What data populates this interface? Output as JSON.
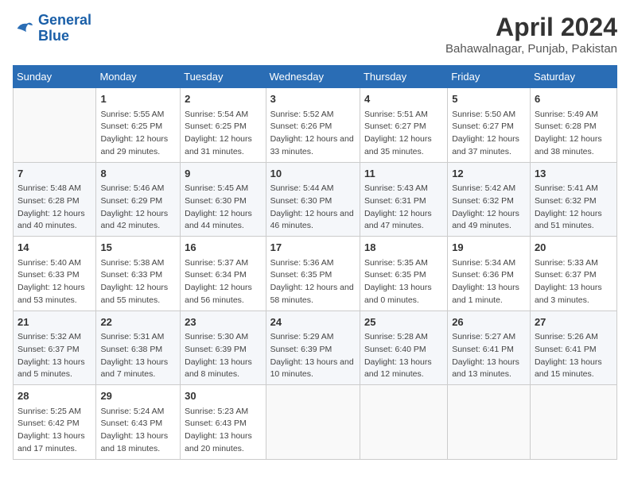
{
  "header": {
    "logo_line1": "General",
    "logo_line2": "Blue",
    "month": "April 2024",
    "location": "Bahawalnagar, Punjab, Pakistan"
  },
  "weekdays": [
    "Sunday",
    "Monday",
    "Tuesday",
    "Wednesday",
    "Thursday",
    "Friday",
    "Saturday"
  ],
  "weeks": [
    [
      {
        "day": "",
        "sunrise": "",
        "sunset": "",
        "daylight": ""
      },
      {
        "day": "1",
        "sunrise": "Sunrise: 5:55 AM",
        "sunset": "Sunset: 6:25 PM",
        "daylight": "Daylight: 12 hours and 29 minutes."
      },
      {
        "day": "2",
        "sunrise": "Sunrise: 5:54 AM",
        "sunset": "Sunset: 6:25 PM",
        "daylight": "Daylight: 12 hours and 31 minutes."
      },
      {
        "day": "3",
        "sunrise": "Sunrise: 5:52 AM",
        "sunset": "Sunset: 6:26 PM",
        "daylight": "Daylight: 12 hours and 33 minutes."
      },
      {
        "day": "4",
        "sunrise": "Sunrise: 5:51 AM",
        "sunset": "Sunset: 6:27 PM",
        "daylight": "Daylight: 12 hours and 35 minutes."
      },
      {
        "day": "5",
        "sunrise": "Sunrise: 5:50 AM",
        "sunset": "Sunset: 6:27 PM",
        "daylight": "Daylight: 12 hours and 37 minutes."
      },
      {
        "day": "6",
        "sunrise": "Sunrise: 5:49 AM",
        "sunset": "Sunset: 6:28 PM",
        "daylight": "Daylight: 12 hours and 38 minutes."
      }
    ],
    [
      {
        "day": "7",
        "sunrise": "Sunrise: 5:48 AM",
        "sunset": "Sunset: 6:28 PM",
        "daylight": "Daylight: 12 hours and 40 minutes."
      },
      {
        "day": "8",
        "sunrise": "Sunrise: 5:46 AM",
        "sunset": "Sunset: 6:29 PM",
        "daylight": "Daylight: 12 hours and 42 minutes."
      },
      {
        "day": "9",
        "sunrise": "Sunrise: 5:45 AM",
        "sunset": "Sunset: 6:30 PM",
        "daylight": "Daylight: 12 hours and 44 minutes."
      },
      {
        "day": "10",
        "sunrise": "Sunrise: 5:44 AM",
        "sunset": "Sunset: 6:30 PM",
        "daylight": "Daylight: 12 hours and 46 minutes."
      },
      {
        "day": "11",
        "sunrise": "Sunrise: 5:43 AM",
        "sunset": "Sunset: 6:31 PM",
        "daylight": "Daylight: 12 hours and 47 minutes."
      },
      {
        "day": "12",
        "sunrise": "Sunrise: 5:42 AM",
        "sunset": "Sunset: 6:32 PM",
        "daylight": "Daylight: 12 hours and 49 minutes."
      },
      {
        "day": "13",
        "sunrise": "Sunrise: 5:41 AM",
        "sunset": "Sunset: 6:32 PM",
        "daylight": "Daylight: 12 hours and 51 minutes."
      }
    ],
    [
      {
        "day": "14",
        "sunrise": "Sunrise: 5:40 AM",
        "sunset": "Sunset: 6:33 PM",
        "daylight": "Daylight: 12 hours and 53 minutes."
      },
      {
        "day": "15",
        "sunrise": "Sunrise: 5:38 AM",
        "sunset": "Sunset: 6:33 PM",
        "daylight": "Daylight: 12 hours and 55 minutes."
      },
      {
        "day": "16",
        "sunrise": "Sunrise: 5:37 AM",
        "sunset": "Sunset: 6:34 PM",
        "daylight": "Daylight: 12 hours and 56 minutes."
      },
      {
        "day": "17",
        "sunrise": "Sunrise: 5:36 AM",
        "sunset": "Sunset: 6:35 PM",
        "daylight": "Daylight: 12 hours and 58 minutes."
      },
      {
        "day": "18",
        "sunrise": "Sunrise: 5:35 AM",
        "sunset": "Sunset: 6:35 PM",
        "daylight": "Daylight: 13 hours and 0 minutes."
      },
      {
        "day": "19",
        "sunrise": "Sunrise: 5:34 AM",
        "sunset": "Sunset: 6:36 PM",
        "daylight": "Daylight: 13 hours and 1 minute."
      },
      {
        "day": "20",
        "sunrise": "Sunrise: 5:33 AM",
        "sunset": "Sunset: 6:37 PM",
        "daylight": "Daylight: 13 hours and 3 minutes."
      }
    ],
    [
      {
        "day": "21",
        "sunrise": "Sunrise: 5:32 AM",
        "sunset": "Sunset: 6:37 PM",
        "daylight": "Daylight: 13 hours and 5 minutes."
      },
      {
        "day": "22",
        "sunrise": "Sunrise: 5:31 AM",
        "sunset": "Sunset: 6:38 PM",
        "daylight": "Daylight: 13 hours and 7 minutes."
      },
      {
        "day": "23",
        "sunrise": "Sunrise: 5:30 AM",
        "sunset": "Sunset: 6:39 PM",
        "daylight": "Daylight: 13 hours and 8 minutes."
      },
      {
        "day": "24",
        "sunrise": "Sunrise: 5:29 AM",
        "sunset": "Sunset: 6:39 PM",
        "daylight": "Daylight: 13 hours and 10 minutes."
      },
      {
        "day": "25",
        "sunrise": "Sunrise: 5:28 AM",
        "sunset": "Sunset: 6:40 PM",
        "daylight": "Daylight: 13 hours and 12 minutes."
      },
      {
        "day": "26",
        "sunrise": "Sunrise: 5:27 AM",
        "sunset": "Sunset: 6:41 PM",
        "daylight": "Daylight: 13 hours and 13 minutes."
      },
      {
        "day": "27",
        "sunrise": "Sunrise: 5:26 AM",
        "sunset": "Sunset: 6:41 PM",
        "daylight": "Daylight: 13 hours and 15 minutes."
      }
    ],
    [
      {
        "day": "28",
        "sunrise": "Sunrise: 5:25 AM",
        "sunset": "Sunset: 6:42 PM",
        "daylight": "Daylight: 13 hours and 17 minutes."
      },
      {
        "day": "29",
        "sunrise": "Sunrise: 5:24 AM",
        "sunset": "Sunset: 6:43 PM",
        "daylight": "Daylight: 13 hours and 18 minutes."
      },
      {
        "day": "30",
        "sunrise": "Sunrise: 5:23 AM",
        "sunset": "Sunset: 6:43 PM",
        "daylight": "Daylight: 13 hours and 20 minutes."
      },
      {
        "day": "",
        "sunrise": "",
        "sunset": "",
        "daylight": ""
      },
      {
        "day": "",
        "sunrise": "",
        "sunset": "",
        "daylight": ""
      },
      {
        "day": "",
        "sunrise": "",
        "sunset": "",
        "daylight": ""
      },
      {
        "day": "",
        "sunrise": "",
        "sunset": "",
        "daylight": ""
      }
    ]
  ]
}
